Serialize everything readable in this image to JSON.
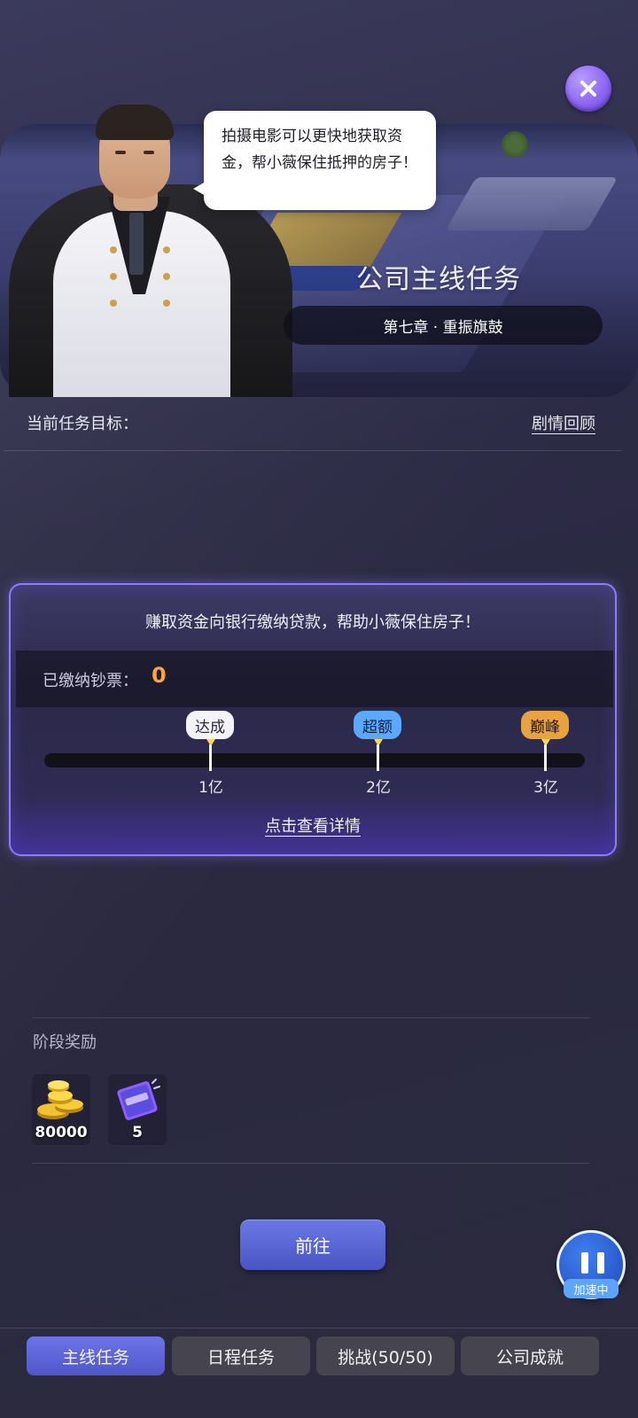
{
  "header": {
    "speech": "拍摄电影可以更快地获取资金，帮小薇保住抵押的房子！",
    "title": "公司主线任务",
    "chapter": "第七章 · 重振旗鼓"
  },
  "target": {
    "label": "当前任务目标：",
    "story_link": "剧情回顾"
  },
  "task": {
    "description": "赚取资金向银行缴纳贷款，帮助小薇保住房子！",
    "paid_label": "已缴纳钞票：",
    "paid_value": "0",
    "progress_fraction": 0,
    "milestones": [
      {
        "tag": "达成",
        "value": "1亿",
        "style": "white"
      },
      {
        "tag": "超额",
        "value": "2亿",
        "style": "blue"
      },
      {
        "tag": "巅峰",
        "value": "3亿",
        "style": "gold"
      }
    ],
    "detail_link": "点击查看详情"
  },
  "rewards": {
    "title": "阶段奖励",
    "items": [
      {
        "icon": "gold-coins-icon",
        "count": "80000"
      },
      {
        "icon": "purple-card-icon",
        "count": "5"
      }
    ]
  },
  "go_button": "前往",
  "speed_label": "加速中",
  "tabs": [
    {
      "label": "主线任务",
      "active": true
    },
    {
      "label": "日程任务",
      "active": false
    },
    {
      "label": "挑战(50/50)",
      "active": false
    },
    {
      "label": "公司成就",
      "active": false
    }
  ],
  "colors": {
    "accent": "#8c7bff",
    "paid_value": "#ffa53a",
    "go_button": "#5a66d6",
    "active_tab": "#5f66d8"
  }
}
